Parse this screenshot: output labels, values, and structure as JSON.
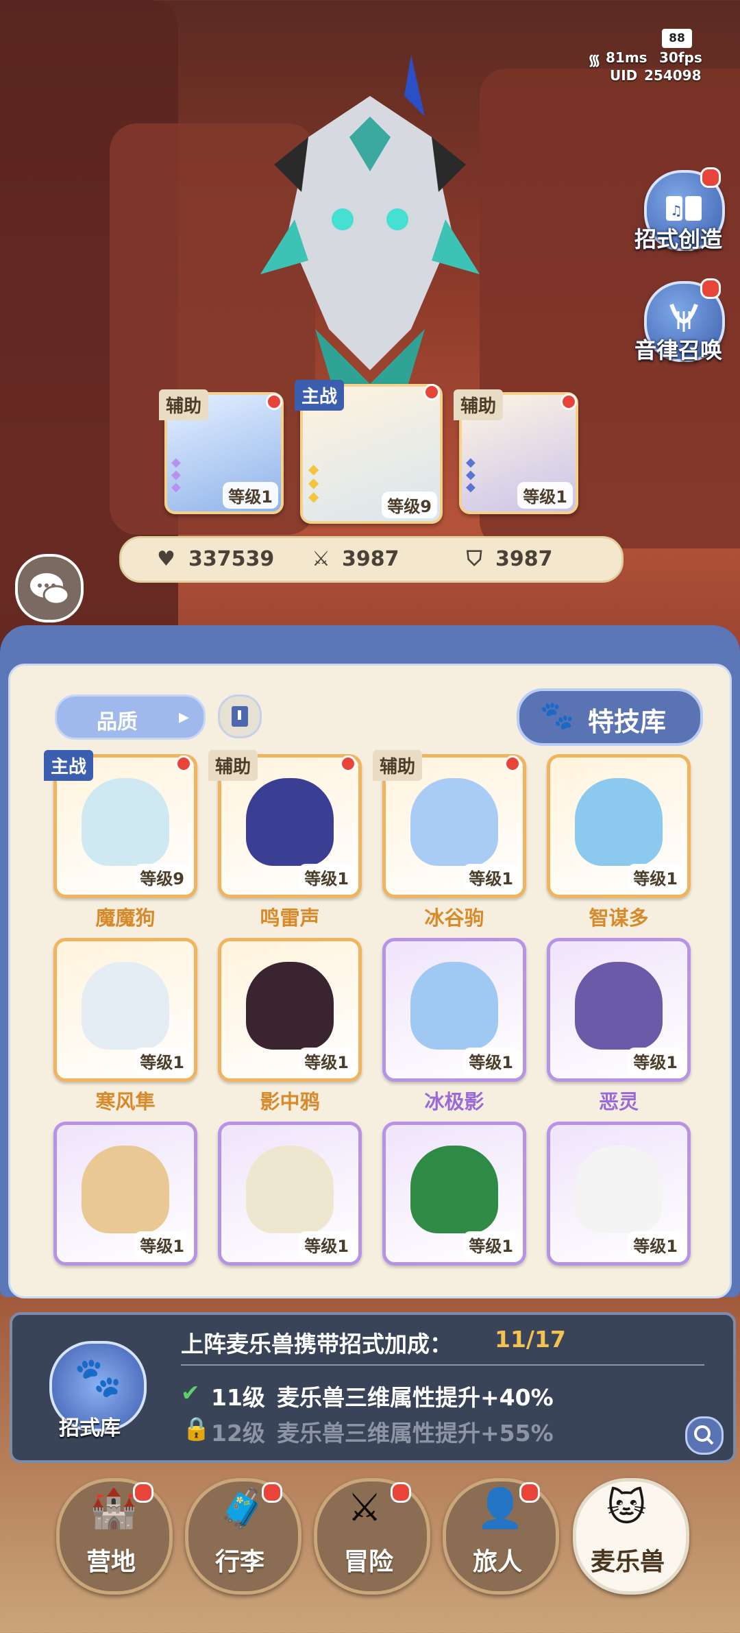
{
  "status": {
    "battery": "88",
    "ping": "81ms",
    "fps": "30fps",
    "uid_label": "UID",
    "uid": "254098"
  },
  "side_buttons": [
    {
      "label": "招式创造",
      "icon": "book-music-icon"
    },
    {
      "label": "音律召唤",
      "icon": "lyre-icon"
    }
  ],
  "team": [
    {
      "role": "辅助",
      "level": "等级1",
      "stars": 3,
      "color": "#9cc6ff"
    },
    {
      "role": "主战",
      "level": "等级9",
      "stars": 3,
      "color": "#bfe7f0"
    },
    {
      "role": "辅助",
      "level": "等级1",
      "stars": 3,
      "color": "#3a3f9a"
    }
  ],
  "stats": {
    "hp": "337539",
    "attack": "3987",
    "defense": "3987"
  },
  "panel": {
    "filter_label": "品质",
    "skill_library_label": "特技库"
  },
  "pets": [
    {
      "name": "魔魔狗",
      "level": "等级9",
      "role": "主战",
      "rarity": "orange",
      "color": "#cfe9f3"
    },
    {
      "name": "鸣雷声",
      "level": "等级1",
      "role": "辅助",
      "rarity": "orange",
      "color": "#3b3f94"
    },
    {
      "name": "冰谷驹",
      "level": "等级1",
      "role": "辅助",
      "rarity": "orange",
      "color": "#a9ccf6"
    },
    {
      "name": "智谋多",
      "level": "等级1",
      "role": "",
      "rarity": "orange",
      "color": "#8cc9ee"
    },
    {
      "name": "寒风隼",
      "level": "等级1",
      "role": "",
      "rarity": "orange",
      "color": "#e4ecf4"
    },
    {
      "name": "影中鸦",
      "level": "等级1",
      "role": "",
      "rarity": "orange",
      "color": "#3a2430"
    },
    {
      "name": "冰极影",
      "level": "等级1",
      "role": "",
      "rarity": "purple",
      "color": "#9fc9f2"
    },
    {
      "name": "恶灵",
      "level": "等级1",
      "role": "",
      "rarity": "purple",
      "color": "#6a5aa8"
    },
    {
      "name": "",
      "level": "等级1",
      "role": "",
      "rarity": "purple",
      "color": "#e9c893"
    },
    {
      "name": "",
      "level": "等级1",
      "role": "",
      "rarity": "purple",
      "color": "#efe6cf"
    },
    {
      "name": "",
      "level": "等级1",
      "role": "",
      "rarity": "purple",
      "color": "#2f8a45"
    },
    {
      "name": "",
      "level": "等级1",
      "role": "",
      "rarity": "purple",
      "color": "#f4f4f4"
    }
  ],
  "info": {
    "badge_label": "招式库",
    "title": "上阵麦乐兽携带招式加成：",
    "progress": "11/17",
    "rows": [
      {
        "level": "11级",
        "text": "麦乐兽三维属性提升+40%",
        "unlocked": true
      },
      {
        "level": "12级",
        "text": "麦乐兽三维属性提升+55%",
        "unlocked": false
      }
    ]
  },
  "nav": [
    {
      "label": "营地",
      "icon": "castle-icon",
      "active": false
    },
    {
      "label": "行李",
      "icon": "chest-icon",
      "active": false
    },
    {
      "label": "冒险",
      "icon": "crossed-swords-icon",
      "active": false
    },
    {
      "label": "旅人",
      "icon": "traveler-icon",
      "active": false
    },
    {
      "label": "麦乐兽",
      "icon": "pet-face-icon",
      "active": true
    }
  ],
  "colors": {
    "panel_blue": "#5c77b8",
    "orange_rarity": "#f0b45e",
    "purple_rarity": "#b793e6",
    "badge_red": "#e9443a"
  }
}
